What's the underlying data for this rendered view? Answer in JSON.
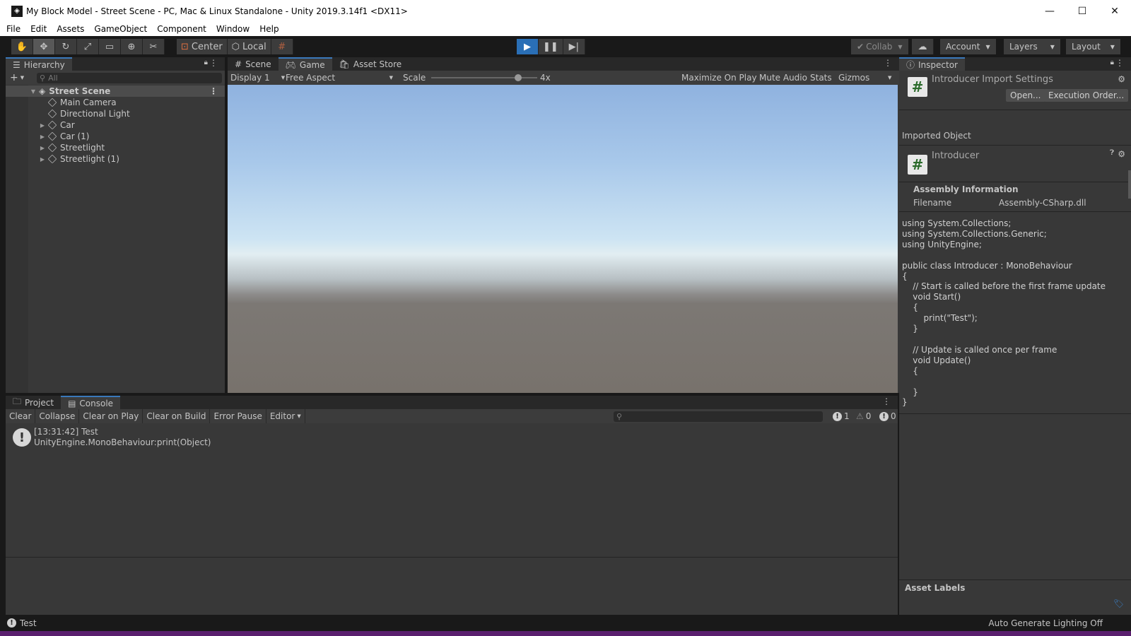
{
  "window": {
    "title": "My Block Model - Street Scene - PC, Mac & Linux Standalone - Unity 2019.3.14f1 <DX11>",
    "controls": [
      "—",
      "☐",
      "✕"
    ]
  },
  "menu": [
    "File",
    "Edit",
    "Assets",
    "GameObject",
    "Component",
    "Window",
    "Help"
  ],
  "toolbar": {
    "pivot": "Center",
    "space": "Local",
    "collab": "Collab",
    "account": "Account",
    "layers": "Layers",
    "layout": "Layout"
  },
  "hierarchy": {
    "tab": "Hierarchy",
    "search_placeholder": "All",
    "root": "Street Scene",
    "items": [
      "Main Camera",
      "Directional Light",
      "Car",
      "Car (1)",
      "Streetlight",
      "Streetlight (1)"
    ]
  },
  "game": {
    "tabs": [
      "Scene",
      "Game",
      "Asset Store"
    ],
    "display": "Display 1",
    "aspect": "Free Aspect",
    "scale_label": "Scale",
    "scale_value": "4x",
    "maximize": "Maximize On Play",
    "mute": "Mute Audio",
    "stats": "Stats",
    "gizmos": "Gizmos"
  },
  "inspector": {
    "tab": "Inspector",
    "header": "Introducer Import Settings",
    "open_button": "Open...",
    "exec_order_button": "Execution Order...",
    "imported_object": "Imported Object",
    "object_name": "Introducer",
    "assembly_info": "Assembly Information",
    "filename_label": "Filename",
    "filename_value": "Assembly-CSharp.dll",
    "code": "using System.Collections;\nusing System.Collections.Generic;\nusing UnityEngine;\n\npublic class Introducer : MonoBehaviour\n{\n    // Start is called before the first frame update\n    void Start()\n    {\n        print(\"Test\");\n    }\n\n    // Update is called once per frame\n    void Update()\n    {\n\n    }\n}",
    "asset_labels": "Asset Labels"
  },
  "console": {
    "tabs": [
      "Project",
      "Console"
    ],
    "buttons": [
      "Clear",
      "Collapse",
      "Clear on Play",
      "Clear on Build",
      "Error Pause",
      "Editor"
    ],
    "counts": {
      "logs": "1",
      "warnings": "0",
      "errors": "0"
    },
    "entry_line1": "[13:31:42] Test",
    "entry_line2": "UnityEngine.MonoBehaviour:print(Object)"
  },
  "status": {
    "message": "Test",
    "lighting": "Auto Generate Lighting Off"
  }
}
